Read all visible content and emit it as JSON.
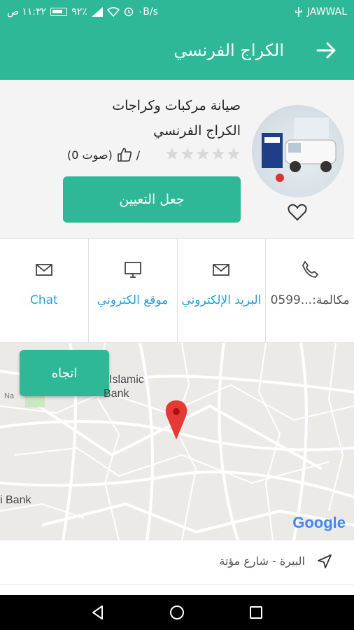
{
  "status_bar": {
    "time": "١١:٣٢ ص",
    "battery": "٩٢٪",
    "speed": "٠B/s",
    "carrier": "JAWWAL"
  },
  "appbar": {
    "title": "الكراج الفرنسي",
    "back_icon": "arrow-right-icon"
  },
  "header": {
    "category": "صيانة مركبات وكراجات",
    "name": "الكراج الفرنسي",
    "rating": 0,
    "votes": "(0 صوت)",
    "separator": "/",
    "assign_button": "جعل التعيين"
  },
  "contacts": [
    {
      "icon": "phone-icon",
      "label": "مكالمة:...0599"
    },
    {
      "icon": "mail-icon",
      "label": "البريد الإلكتروني"
    },
    {
      "icon": "monitor-icon",
      "label": "موقع الكتروني"
    },
    {
      "icon": "mail-icon",
      "label": "Chat"
    }
  ],
  "map": {
    "direction_button": "اتجاه",
    "label_islamic": "Islamic",
    "label_bank": "Bank",
    "label_ibank": "i Bank",
    "label_na": "Na",
    "google": "Google"
  },
  "address": {
    "text": "البيرة - شارع مؤتة"
  },
  "colors": {
    "primary": "#2eb898",
    "link": "#2a9fd8"
  }
}
